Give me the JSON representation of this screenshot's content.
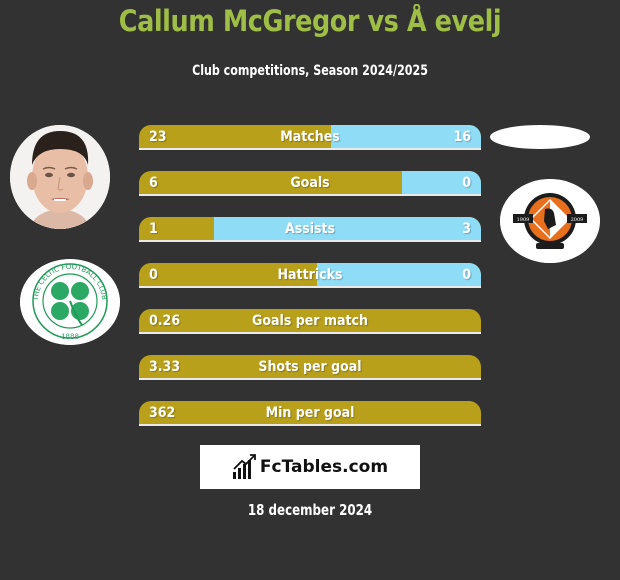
{
  "header": {
    "title": "Callum McGregor vs Å evelj",
    "subtitle": "Club competitions, Season 2024/2025"
  },
  "colors": {
    "background": "#323232",
    "title": "#9fbe45",
    "left_bar": "#b8a01b",
    "right_bar": "#8fdcf6"
  },
  "players": {
    "left": {
      "name": "Callum McGregor",
      "photo": "player-photo",
      "club_crest": "celtic-crest"
    },
    "right": {
      "name": "Å evelj",
      "photo": "blank-oval",
      "club_crest": "dundee-united-crest"
    }
  },
  "stats": [
    {
      "label": "Matches",
      "left": "23",
      "right": "16",
      "right_share": 0.44
    },
    {
      "label": "Goals",
      "left": "6",
      "right": "0",
      "right_share": 0.23
    },
    {
      "label": "Assists",
      "left": "1",
      "right": "3",
      "right_share": 0.78
    },
    {
      "label": "Hattricks",
      "left": "0",
      "right": "0",
      "right_share": 0.48
    },
    {
      "label": "Goals per match",
      "left": "0.26",
      "right": "",
      "right_share": 0
    },
    {
      "label": "Shots per goal",
      "left": "3.33",
      "right": "",
      "right_share": 0
    },
    {
      "label": "Min per goal",
      "left": "362",
      "right": "",
      "right_share": 0
    }
  ],
  "footer": {
    "logo_text": "FcTables.com",
    "logo_icon": "bar-chart-icon",
    "date": "18 december 2024"
  }
}
